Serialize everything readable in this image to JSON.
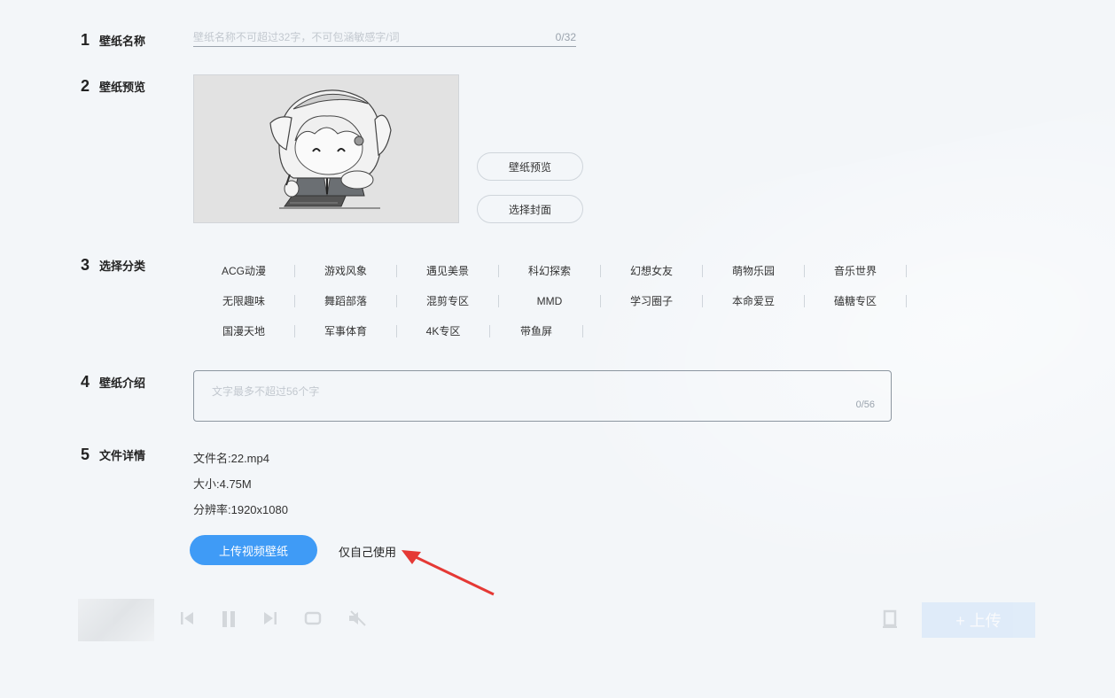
{
  "steps": [
    {
      "num": "1",
      "label": "壁纸名称"
    },
    {
      "num": "2",
      "label": "壁纸预览"
    },
    {
      "num": "3",
      "label": "选择分类"
    },
    {
      "num": "4",
      "label": "壁纸介绍"
    },
    {
      "num": "5",
      "label": "文件详情"
    }
  ],
  "name_field": {
    "placeholder": "壁纸名称不可超过32字，不可包涵敏感字/词",
    "value": "",
    "counter": "0/32"
  },
  "preview": {
    "preview_button": "壁纸预览",
    "cover_button": "选择封面"
  },
  "categories": {
    "rows": [
      [
        "ACG动漫",
        "游戏风象",
        "遇见美景",
        "科幻探索",
        "幻想女友",
        "萌物乐园",
        "音乐世界"
      ],
      [
        "无限趣味",
        "舞蹈部落",
        "混剪专区",
        "MMD",
        "学习圈子",
        "本命爱豆",
        "磕糖专区"
      ],
      [
        "国漫天地",
        "军事体育",
        "4K专区",
        "带鱼屏"
      ]
    ]
  },
  "intro": {
    "placeholder": "文字最多不超过56个字",
    "value": "",
    "counter": "0/56"
  },
  "file": {
    "name": "文件名:22.mp4",
    "size": "大小:4.75M",
    "resolution": "分辨率:1920x1080"
  },
  "actions": {
    "upload_label": "上传视频壁纸",
    "self_use_label": "仅自己使用"
  },
  "player": {
    "upload_label": "+ 上传"
  },
  "colors": {
    "accent": "#3f9bf6",
    "arrow": "#e53935",
    "background": "#f3f6f9"
  }
}
